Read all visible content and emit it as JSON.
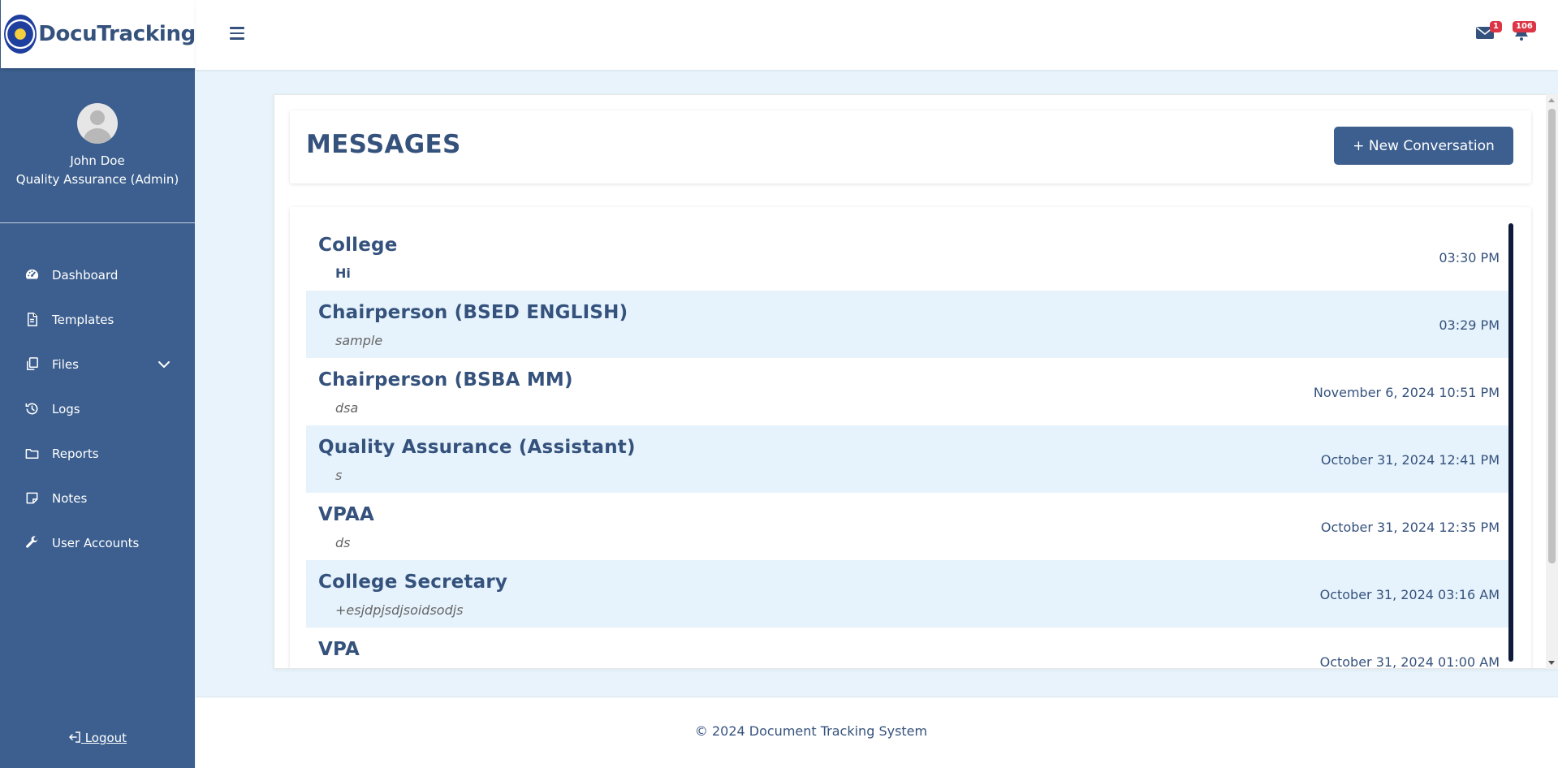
{
  "brand": {
    "name": "DocuTracking"
  },
  "user": {
    "name": "John Doe",
    "role": "Quality Assurance (Admin)"
  },
  "sidebar": {
    "items": [
      {
        "label": "Dashboard",
        "icon": "gauge-icon"
      },
      {
        "label": "Templates",
        "icon": "document-icon"
      },
      {
        "label": "Files",
        "icon": "files-icon",
        "has_submenu": true
      },
      {
        "label": "Logs",
        "icon": "history-icon"
      },
      {
        "label": "Reports",
        "icon": "folder-icon"
      },
      {
        "label": "Notes",
        "icon": "note-icon"
      },
      {
        "label": "User Accounts",
        "icon": "wrench-icon"
      }
    ],
    "logout_label": "Logout"
  },
  "topbar": {
    "messages_badge": "1",
    "notifications_badge": "106"
  },
  "page": {
    "title": "MESSAGES",
    "new_conversation_label": "+ New Conversation"
  },
  "conversations": [
    {
      "name": "College",
      "preview": "Hi",
      "time": "03:30 PM",
      "unread": true
    },
    {
      "name": "Chairperson (BSED ENGLISH)",
      "preview": "sample",
      "time": "03:29 PM",
      "unread": false
    },
    {
      "name": "Chairperson (BSBA MM)",
      "preview": "dsa",
      "time": "November 6, 2024 10:51 PM",
      "unread": false
    },
    {
      "name": "Quality Assurance (Assistant)",
      "preview": "s",
      "time": "October 31, 2024 12:41 PM",
      "unread": false
    },
    {
      "name": "VPAA",
      "preview": "ds",
      "time": "October 31, 2024 12:35 PM",
      "unread": false
    },
    {
      "name": "College Secretary",
      "preview": "+esjdpjsdjsoidsodjs",
      "time": "October 31, 2024 03:16 AM",
      "unread": false
    },
    {
      "name": "VPA",
      "preview": "",
      "time": "October 31, 2024 01:00 AM",
      "unread": false
    }
  ],
  "footer": {
    "text": "© 2024 Document Tracking System"
  },
  "colors": {
    "primary": "#3c5f8f",
    "text": "#35527d",
    "background": "#e8f3fb",
    "row_alt": "#e6f3fc",
    "badge": "#dc3545"
  }
}
